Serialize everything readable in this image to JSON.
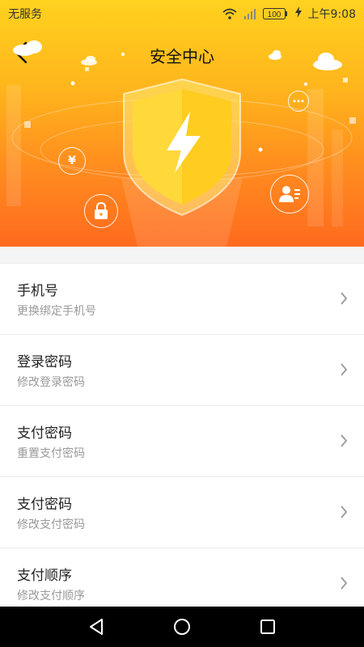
{
  "statusbar": {
    "carrier": "无服务",
    "battery": "100",
    "time": "上午9:08"
  },
  "header": {
    "title": "安全中心"
  },
  "hero": {
    "yen_symbol": "¥"
  },
  "items": [
    {
      "title": "手机号",
      "subtitle": "更换绑定手机号"
    },
    {
      "title": "登录密码",
      "subtitle": "修改登录密码"
    },
    {
      "title": "支付密码",
      "subtitle": "重置支付密码"
    },
    {
      "title": "支付密码",
      "subtitle": "修改支付密码"
    },
    {
      "title": "支付顺序",
      "subtitle": "修改支付顺序"
    }
  ],
  "colors": {
    "hero_top": "#ffd21f",
    "hero_bottom": "#ff6a1e",
    "shield_fill": "#ffd83a"
  }
}
